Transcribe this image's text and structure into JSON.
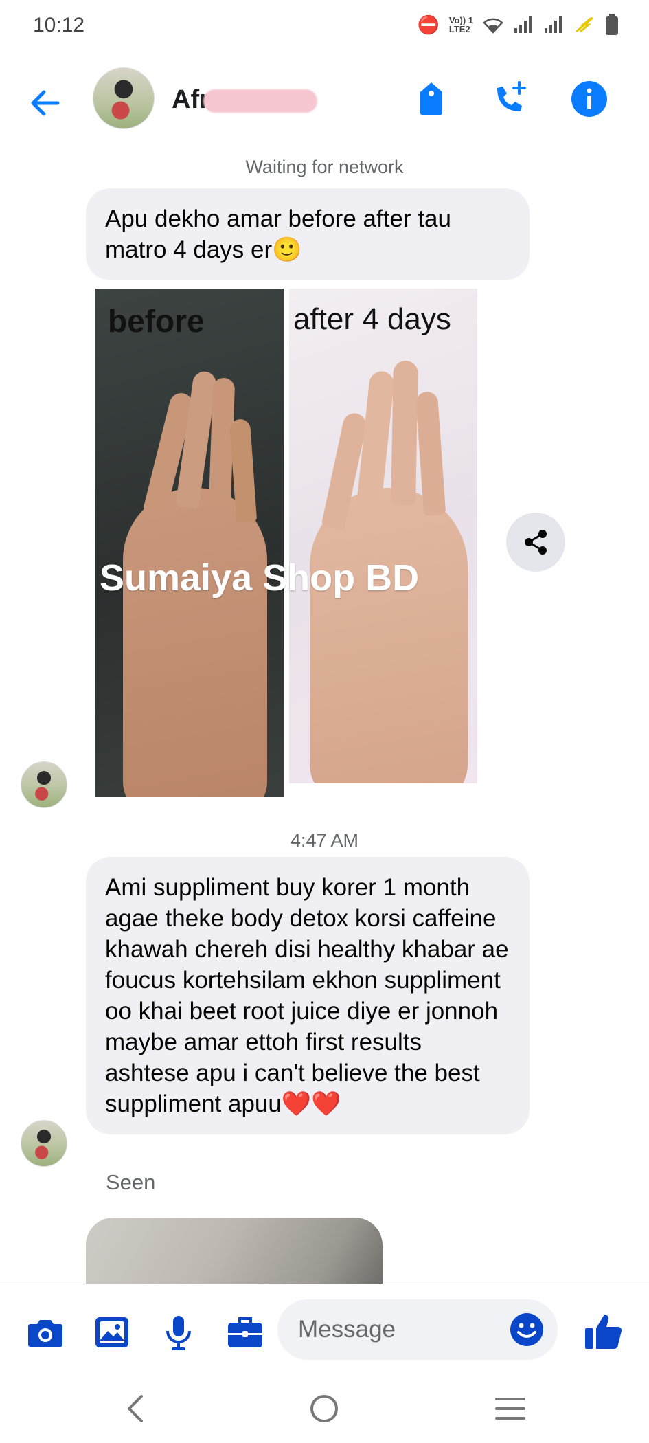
{
  "status_bar": {
    "time": "10:12",
    "lte_line1": "Vo)) 1",
    "lte_line2": "LTE2"
  },
  "header": {
    "contact_name": "Afr"
  },
  "chat": {
    "network_status": "Waiting for network",
    "message_1": "Apu dekho amar before after tau matro 4 days er🙂",
    "image_1": {
      "label_before": "before",
      "label_after": "after 4 days",
      "watermark": "Sumaiya Shop BD"
    },
    "timestamp": "4:47 AM",
    "message_2": "Ami suppliment buy korer 1 month agae theke body detox korsi caffeine khawah chereh disi healthy khabar ae foucus kortehsilam ekhon suppliment oo khai beet root juice diye er jonnoh maybe amar ettoh first results ashtese apu i can't believe the best suppliment apuu❤️❤️",
    "seen_status": "Seen"
  },
  "composer": {
    "placeholder": "Message"
  },
  "colors": {
    "accent": "#0a7cff",
    "composer_icon": "#0a46c8",
    "bubble": "#f0f0f4",
    "secondary_text": "#65676b",
    "redaction": "#f6c6d1"
  },
  "icons": {
    "header": [
      "back-arrow-icon",
      "tag-icon",
      "call-plus-icon",
      "info-icon"
    ],
    "composer": [
      "camera-icon",
      "gallery-icon",
      "mic-icon",
      "briefcase-icon",
      "emoji-icon",
      "thumbs-up-icon"
    ],
    "navbar": [
      "nav-back-icon",
      "nav-home-icon",
      "nav-menu-icon"
    ]
  }
}
